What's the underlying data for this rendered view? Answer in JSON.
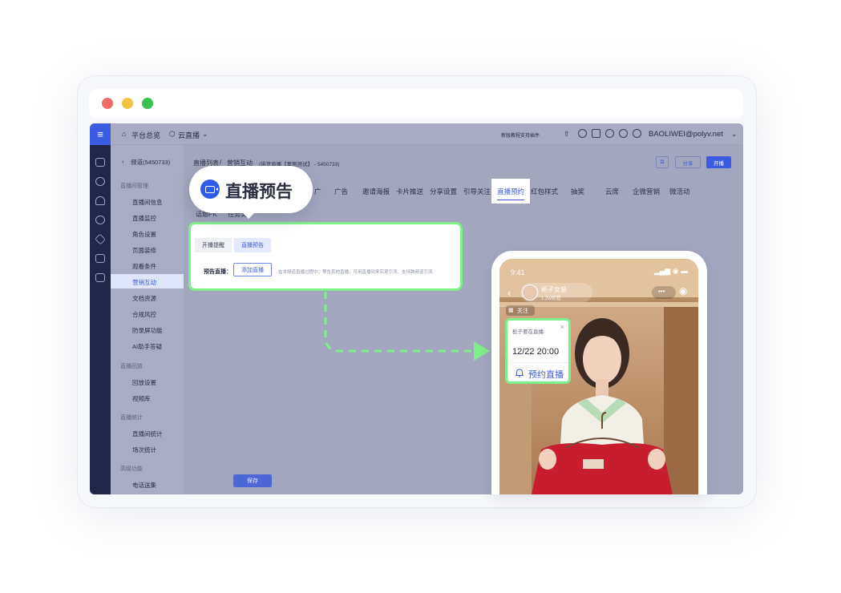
{
  "topbar": {
    "home": "平台总览",
    "cloud": "云直播",
    "notice": "新版教程支持插件",
    "account": "BAOLIWEI@polyv.net"
  },
  "sidebar": {
    "channel": "频道(5450733)",
    "sections": [
      {
        "label": "直播间管理",
        "items": [
          "直播间信息",
          "直播监控",
          "角色设置",
          "页面装修",
          "观看条件",
          "营销互动",
          "文档资源",
          "合规风控",
          "防录屏功能",
          "AI助手答疑"
        ]
      },
      {
        "label": "直播回放",
        "items": [
          "回放设置",
          "视频库"
        ]
      },
      {
        "label": "直播统计",
        "items": [
          "直播间统计",
          "场次统计"
        ]
      },
      {
        "label": "高级功能",
        "items": [
          "电话送集"
        ]
      }
    ],
    "active": "营销互动"
  },
  "header": {
    "breadcrumb_root": "直播列表",
    "breadcrumb_sep": "/",
    "breadcrumb_current": "营销互动",
    "channel_info": "(带货直播【案例测试】 - 5450733)",
    "share": "分享",
    "start": "开播"
  },
  "tabs": [
    "广",
    "广告",
    "邀请海报",
    "卡片推送",
    "分享设置",
    "引导关注",
    "直播预约",
    "红包样式",
    "抽奖",
    "云席",
    "企微营销",
    "微活动"
  ],
  "active_tab": "直播预约",
  "subtabs": [
    "话题PK",
    "任务奖"
  ],
  "callout": {
    "text": "直播预告"
  },
  "panel": {
    "tab_1": "开播提醒",
    "tab_2": "直播预告",
    "label": "预告直播：",
    "add_button": "添加直播",
    "desc": "在本频道直播过程中，预告其他直播，可用直播间来实现引流、支持跨频道引流"
  },
  "save": "保存",
  "phone": {
    "time": "9:41",
    "host_name": "栀子女装",
    "viewers": "1.2w观看",
    "follow": "关注",
    "more": "•••"
  },
  "card": {
    "title": "栀子要在直播",
    "time": "12/22 20:00",
    "button": "预约直播",
    "close": "×"
  },
  "colors": {
    "accent": "#3c5be4",
    "highlight": "#7ef08a"
  }
}
